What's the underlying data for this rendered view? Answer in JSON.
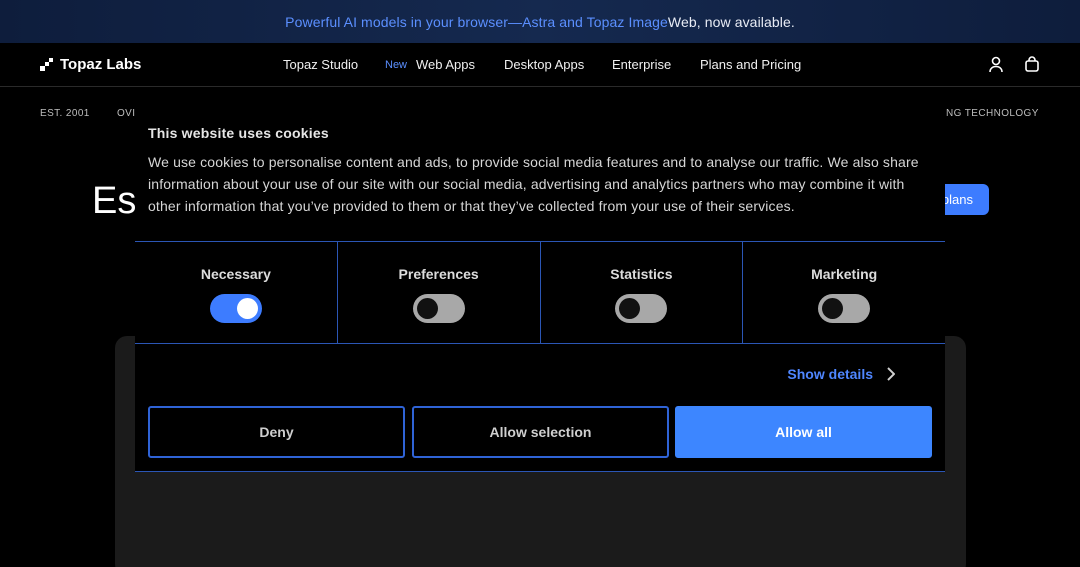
{
  "announcement": {
    "highlight": "Powerful AI models in your browser—Astra and Topaz Image",
    "rest": " Web, now available."
  },
  "nav": {
    "logo_text": "Topaz Labs",
    "links": [
      "Topaz Studio",
      "Web Apps",
      "Desktop Apps",
      "Enterprise",
      "Plans and Pricing"
    ],
    "new_badge": "New"
  },
  "page": {
    "meta_left": "EST. 2001",
    "meta_mid": "OVI",
    "meta_right": "NG TECHNOLOGY",
    "hero_fragment": "Es",
    "cta_fragment": "plans"
  },
  "cookie": {
    "title": "This website uses cookies",
    "body": "We use cookies to personalise content and ads, to provide social media features and to analyse our traffic. We also share information about your use of our site with our social media, advertising and analytics partners who may combine it with other information that you’ve provided to them or that they’ve collected from your use of their services.",
    "categories": [
      {
        "label": "Necessary",
        "on": true
      },
      {
        "label": "Preferences",
        "on": false
      },
      {
        "label": "Statistics",
        "on": false
      },
      {
        "label": "Marketing",
        "on": false
      }
    ],
    "show_details": "Show details",
    "buttons": {
      "deny": "Deny",
      "allow_selection": "Allow selection",
      "allow_all": "Allow all"
    }
  },
  "colors": {
    "accent": "#3d86ff",
    "link": "#4f86ff",
    "border": "#2b56b5"
  }
}
